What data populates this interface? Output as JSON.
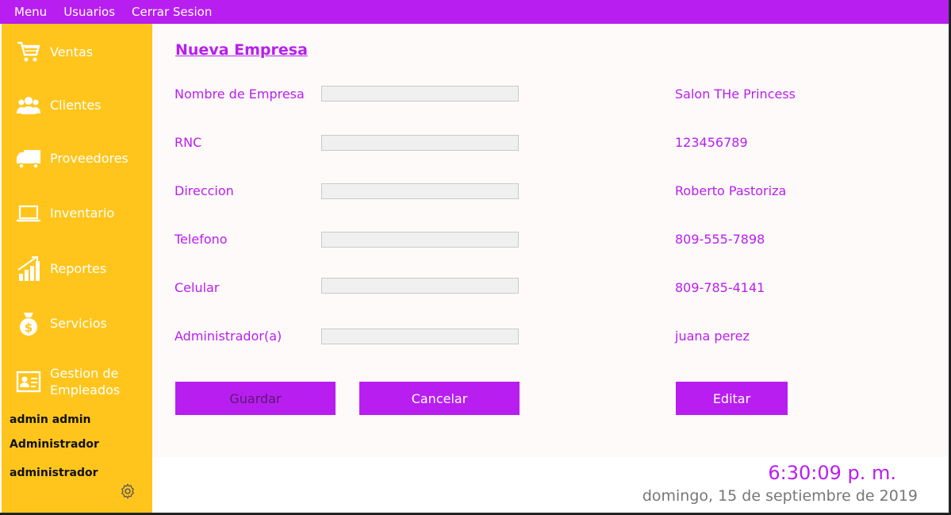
{
  "menu": {
    "items": [
      {
        "label": "Menu"
      },
      {
        "label": "Usuarios"
      },
      {
        "label": "Cerrar Sesion"
      }
    ]
  },
  "sidebar": {
    "items": [
      {
        "label": "Ventas",
        "icon": "cart-icon"
      },
      {
        "label": "Clientes",
        "icon": "users-icon"
      },
      {
        "label": "Proveedores",
        "icon": "truck-icon"
      },
      {
        "label": "Inventario",
        "icon": "laptop-icon"
      },
      {
        "label": "Reportes",
        "icon": "bar-chart-icon"
      },
      {
        "label": "Servicios",
        "icon": "money-bag-icon"
      },
      {
        "label": "Gestion de Empleados",
        "icon": "id-card-icon"
      }
    ],
    "user": {
      "name": "admin admin",
      "role": "Administrador",
      "username": "administrador"
    },
    "settings_icon": "gear-icon"
  },
  "form": {
    "title": "Nueva Empresa",
    "fields": [
      {
        "label": "Nombre de Empresa",
        "value": "",
        "current": "Salon THe Princess"
      },
      {
        "label": "RNC",
        "value": "",
        "current": "123456789"
      },
      {
        "label": "Direccion",
        "value": "",
        "current": "Roberto Pastoriza"
      },
      {
        "label": "Telefono",
        "value": "",
        "current": "809-555-7898"
      },
      {
        "label": "Celular",
        "value": "",
        "current": "809-785-4141"
      },
      {
        "label": "Administrador(a)",
        "value": "",
        "current": "juana perez"
      }
    ],
    "buttons": {
      "save": "Guardar",
      "cancel": "Cancelar",
      "edit": "Editar"
    }
  },
  "footer": {
    "time": "6:30:09 p. m.",
    "date": "domingo, 15 de septiembre de 2019"
  },
  "colors": {
    "accent": "#b81ef0",
    "sidebar": "#ffc51c",
    "background": "#fffafa"
  }
}
